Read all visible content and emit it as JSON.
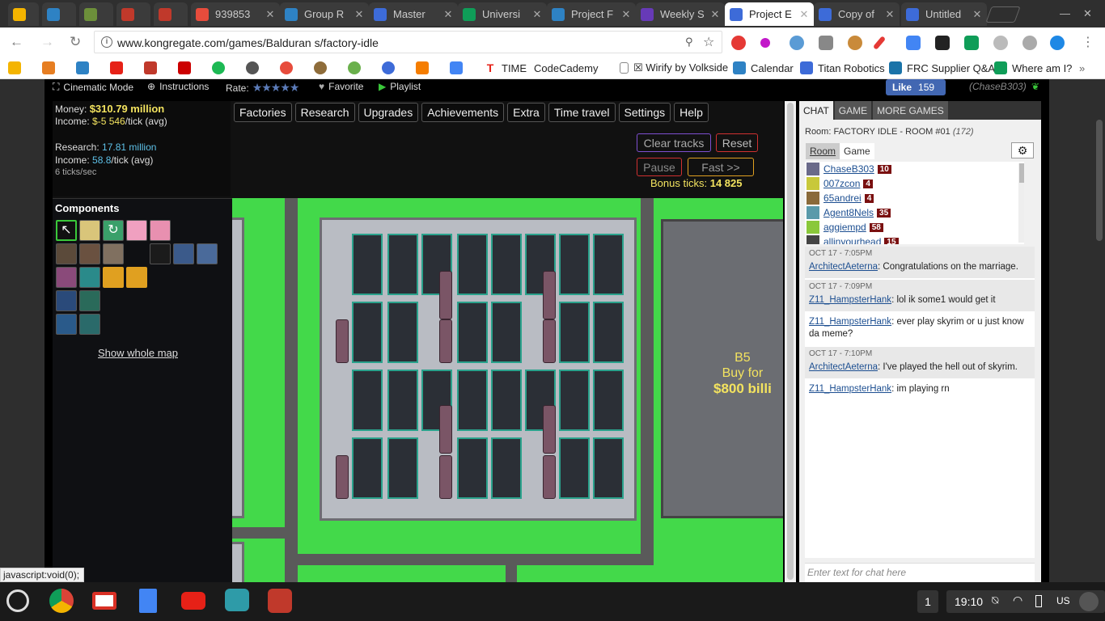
{
  "browser": {
    "tabs": [
      {
        "title": "",
        "color": "#f4b400"
      },
      {
        "title": "",
        "color": "#2e82c4"
      },
      {
        "title": "",
        "color": "#6c8f3a"
      },
      {
        "title": "",
        "color": "#c0392b"
      },
      {
        "title": "",
        "color": "#c0392b"
      },
      {
        "title": "939853",
        "color": "#e74c3c"
      },
      {
        "title": "Group R",
        "color": "#2e82c4"
      },
      {
        "title": "Master",
        "color": "#3d6bd8"
      },
      {
        "title": "Universi",
        "color": "#0f9d58"
      },
      {
        "title": "Project F",
        "color": "#2e82c4"
      },
      {
        "title": "Weekly S",
        "color": "#673ab7"
      },
      {
        "title": "Project E",
        "color": "#3d6bd8"
      },
      {
        "title": "Copy of",
        "color": "#3d6bd8"
      },
      {
        "title": "Untitled",
        "color": "#3d6bd8"
      }
    ],
    "url": "www.kongregate.com/games/Balduran s/factory-idle",
    "bookmarks": [
      {
        "label": "",
        "color": "#f4b400"
      },
      {
        "label": "",
        "color": "#e67e22"
      },
      {
        "label": "",
        "color": "#2e82c4"
      },
      {
        "label": "",
        "color": "#e62117"
      },
      {
        "label": "",
        "color": "#c0392b"
      },
      {
        "label": "",
        "color": "#cc0000"
      },
      {
        "label": "",
        "color": "#1db954"
      },
      {
        "label": "",
        "color": "#555555"
      },
      {
        "label": "",
        "color": "#e74c3c"
      },
      {
        "label": "",
        "color": "#8e6c3a"
      },
      {
        "label": "",
        "color": "#6ab04c"
      },
      {
        "label": "",
        "color": "#3d6bd8"
      },
      {
        "label": "",
        "color": "#f57d00"
      },
      {
        "label": "",
        "color": "#4285f4"
      },
      {
        "label": "TIME",
        "color": "#e62117"
      },
      {
        "label": "CodeCademy",
        "color": "#ffffff"
      },
      {
        "label": "☒ Wirify by Volkside",
        "color": "#ffffff"
      },
      {
        "label": "Calendar",
        "color": "#2e82c4"
      },
      {
        "label": "Titan Robotics",
        "color": "#3d6bd8"
      },
      {
        "label": "FRC Supplier Q&A",
        "color": "#1a73a8"
      },
      {
        "label": "Where am I?",
        "color": "#0f9d58"
      }
    ]
  },
  "gamebar": {
    "cinematic": "Cinematic Mode",
    "instructions": "Instructions",
    "rate": "Rate:",
    "stars": "★★★★★",
    "favorite": "Favorite",
    "playlist": "Playlist",
    "like_label": "Like",
    "like_count": "159",
    "username": "(ChaseB303)"
  },
  "stats": {
    "money_label": "Money:",
    "money_value": "$310.79 million",
    "income_label": "Income:",
    "money_income": "$-5 546",
    "money_income_unit": "/tick (avg)",
    "research_label": "Research:",
    "research_value": "17.81 million",
    "research_income_label": "Income:",
    "research_income": "58.8",
    "research_income_unit": "/tick (avg)",
    "ticks": "6 ticks/sec"
  },
  "menu": [
    "Factories",
    "Research",
    "Upgrades",
    "Achievements",
    "Extra",
    "Time travel",
    "Settings",
    "Help"
  ],
  "controls": {
    "clear_tracks": "Clear tracks",
    "reset": "Reset",
    "pause": "Pause",
    "fast": "Fast >>",
    "bonus_label": "Bonus ticks:",
    "bonus_value": "14 825"
  },
  "components": {
    "title": "Components",
    "show_map": "Show whole map"
  },
  "map": {
    "factory_name": "B5",
    "buy_label": "Buy for",
    "buy_price": "$800 billi"
  },
  "chat": {
    "tabs": [
      "CHAT",
      "GAME",
      "MORE GAMES"
    ],
    "room_label": "Room:",
    "room_name": "FACTORY IDLE - ROOM #01",
    "room_count": "(172)",
    "subtabs": [
      "Room",
      "Game"
    ],
    "users": [
      {
        "name": "ChaseB303",
        "level": "10"
      },
      {
        "name": "007zcon",
        "level": "4"
      },
      {
        "name": "65andrei",
        "level": "4"
      },
      {
        "name": "Agent8Nels",
        "level": "35"
      },
      {
        "name": "aggiempd",
        "level": "58"
      },
      {
        "name": "allinyourhead",
        "level": "15"
      }
    ],
    "messages": [
      {
        "timestamp": "OCT 17 - 7:05PM",
        "user": "ArchitectAeterna",
        "text": ": Congratulations on the marriage."
      },
      {
        "timestamp": "OCT 17 - 7:09PM",
        "user": "Z11_HampsterHank",
        "text": ": lol ik some1 would get it"
      },
      {
        "timestamp": "",
        "user": "Z11_HampsterHank",
        "text": ": ever play skyrim or u just know da meme?"
      },
      {
        "timestamp": "OCT 17 - 7:10PM",
        "user": "ArchitectAeterna",
        "text": ": I've played the hell out of skyrim."
      },
      {
        "timestamp": "",
        "user": "Z11_HampsterHank",
        "text": ": im playing rn"
      }
    ],
    "input_placeholder": "Enter text for chat here"
  },
  "status_url": "javascript:void(0);",
  "shelf": {
    "apps": [
      {
        "name": "chrome",
        "color": "#db4437"
      },
      {
        "name": "gmail",
        "color": "#d93025"
      },
      {
        "name": "docs",
        "color": "#4285f4"
      },
      {
        "name": "youtube",
        "color": "#e62117"
      },
      {
        "name": "camera",
        "color": "#2e9ba8"
      },
      {
        "name": "photos",
        "color": "#c0392b"
      }
    ],
    "notifications": "1",
    "time": "19:10",
    "locale": "US"
  }
}
